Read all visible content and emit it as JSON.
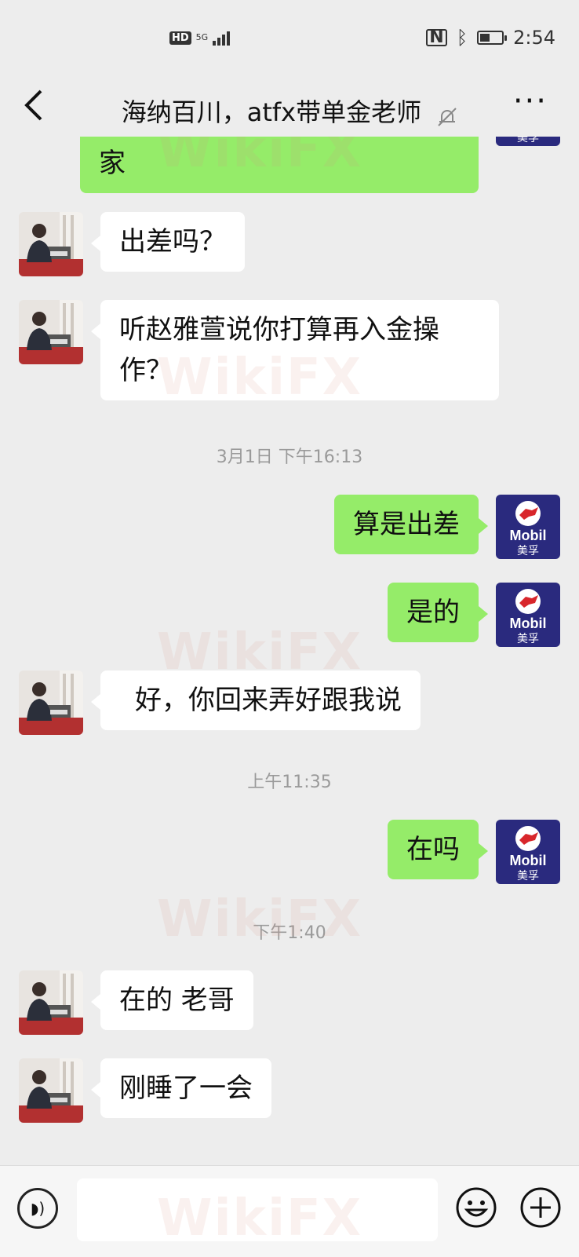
{
  "status_bar": {
    "network": "HD",
    "signal": "5G",
    "time": "2:54",
    "battery_level": 0.45
  },
  "header": {
    "title": "海纳百川，atfx带单金老师",
    "back_icon": "chevron-left-icon",
    "mute_icon": "bell-muted-icon",
    "more_icon": "ellipsis-icon"
  },
  "mobil_avatar": {
    "brand": "Mobil",
    "sub": "美孚"
  },
  "messages": [
    {
      "side": "out",
      "text": "家"
    },
    {
      "side": "in",
      "text": "出差吗？"
    },
    {
      "side": "in",
      "text_line1": "听赵雅萱说你打算再入金操",
      "text_line2": "作？"
    },
    {
      "type": "time",
      "text": "3月1日 下午16:13"
    },
    {
      "side": "out",
      "text": "算是出差"
    },
    {
      "side": "out",
      "text": "是的"
    },
    {
      "side": "in",
      "text": "好，你回来弄好跟我说"
    },
    {
      "type": "time",
      "text": "上午11:35"
    },
    {
      "side": "out",
      "text": "在吗"
    },
    {
      "type": "time",
      "text": "下午1:40"
    },
    {
      "side": "in",
      "text": "在的 老哥"
    },
    {
      "side": "in",
      "text": "刚睡了一会"
    }
  ],
  "watermark": "WikiFX",
  "colors": {
    "background": "#ededed",
    "outgoing_bubble": "#95ec69",
    "incoming_bubble": "#ffffff",
    "mobil_blue": "#2a2a7e",
    "mobil_red": "#d8262b"
  }
}
